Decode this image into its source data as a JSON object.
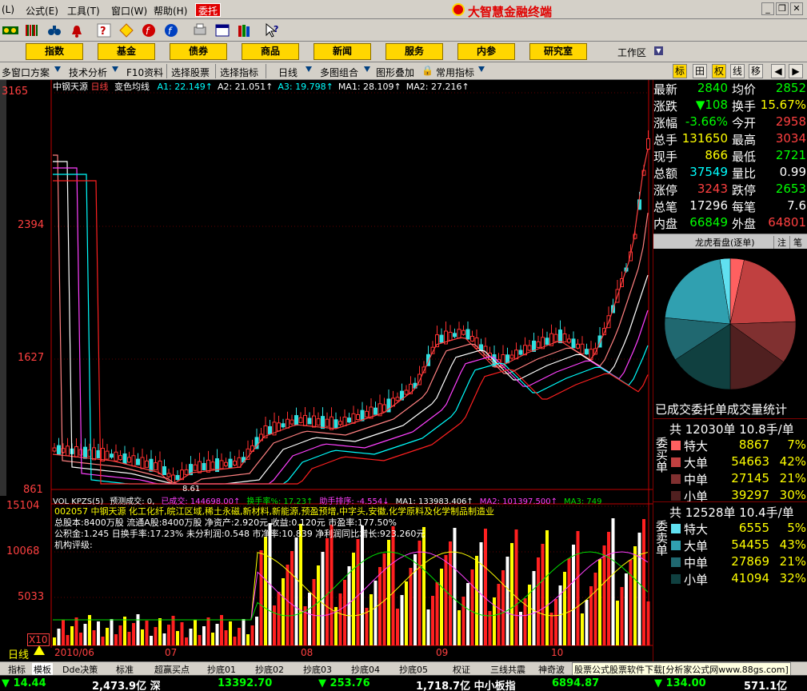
{
  "app_title": "大智慧金融终端",
  "menu": {
    "items": [
      "(L)",
      "公式(E)",
      "工具(T)",
      "窗口(W)",
      "帮助(H)"
    ],
    "weituo": "委托"
  },
  "categories": [
    "指数",
    "基金",
    "债券",
    "商品",
    "新闻",
    "服务",
    "内参",
    "研究室"
  ],
  "workspace": "工作区",
  "subtoolbar": {
    "items": [
      "多窗口方案",
      "技术分析",
      "F10资料",
      "选择股票",
      "选择指标",
      "日线",
      "多图组合",
      "图形叠加",
      "常用指标"
    ]
  },
  "right_tabs": [
    "标",
    "田",
    "权",
    "线",
    "移"
  ],
  "chart": {
    "stock_name": "中钢天源",
    "period": "日线",
    "indicator": "变色均线",
    "ma_line": [
      {
        "label": "A1: 22.149↑",
        "value": "22.149↑",
        "color": "#00ffff"
      },
      {
        "label": "A2: 21.051↑",
        "value": "21.051↑",
        "color": "#ffffff"
      },
      {
        "label": "A3: 19.798↑",
        "value": "19.798↑",
        "color": "#00ffff"
      },
      {
        "label": "MA1: 28.109↑",
        "value": "28.109↑",
        "color": "#ffffff"
      },
      {
        "label": "MA2: 27.216↑",
        "value": "",
        "color": "#ffffff"
      }
    ],
    "price_axis": [
      "3165",
      "2394",
      "1627",
      "861"
    ],
    "low_label": "8.61",
    "vol_header": [
      {
        "t": "VOL KPZS(5)",
        "c": "#ffffff"
      },
      {
        "t": "预测成交: 0,",
        "c": "#ffffff"
      },
      {
        "t": "已成交: 144698.00↑",
        "c": "#ff40ff"
      },
      {
        "t": "换手率%: 17.23↑",
        "c": "#00e000"
      },
      {
        "t": "助手排序: -4.554↓",
        "c": "#ff40ff"
      },
      {
        "t": "MA1: 133983.406↑",
        "c": "#ffffff"
      },
      {
        "t": "MA2: 101397.500↑",
        "c": "#ff40ff"
      },
      {
        "t": "MA3: 749",
        "c": "#00e000"
      }
    ],
    "info_lines": [
      "002057 中钢天源 化工化纤,皖江区域,稀土永磁,新材料,新能源,预盈预增,中字头,安徽,化学原料及化学制品制造业",
      "总股本:8400万股 流通A股:8400万股 净资产:2.920元 收益:0.120元 市盈率:177.50%",
      "公积金:1.245 日换手率:17.23% 未分利润:0.548 市净率:10.839 净利润同比增长:923.260元",
      "机构评级:"
    ],
    "vol_axis": [
      "15104",
      "10068",
      "5033",
      "X10"
    ],
    "date_axis": [
      "2010/06",
      "07",
      "08",
      "09",
      "10"
    ],
    "period_tag": "日线"
  },
  "quote": [
    {
      "l1": "最新",
      "v1": "2840",
      "c1": "#00ff00",
      "l2": "均价",
      "v2": "2852",
      "c2": "#00ff00"
    },
    {
      "l1": "涨跌",
      "v1": "▼108",
      "c1": "#00ff00",
      "l2": "换手",
      "v2": "15.67%",
      "c2": "#ffff00"
    },
    {
      "l1": "涨幅",
      "v1": "-3.66%",
      "c1": "#00ff00",
      "l2": "今开",
      "v2": "2958",
      "c2": "#ff4040"
    },
    {
      "l1": "总手",
      "v1": "131650",
      "c1": "#ffff00",
      "l2": "最高",
      "v2": "3034",
      "c2": "#ff4040"
    },
    {
      "l1": "现手",
      "v1": "866",
      "c1": "#ffff00",
      "l2": "最低",
      "v2": "2721",
      "c2": "#00ff00"
    },
    {
      "l1": "总额",
      "v1": "37549",
      "c1": "#00ffff",
      "l2": "量比",
      "v2": "0.99",
      "c2": "#ffffff"
    },
    {
      "l1": "涨停",
      "v1": "3243",
      "c1": "#ff4040",
      "l2": "跌停",
      "v2": "2653",
      "c2": "#00ff00"
    },
    {
      "l1": "总笔",
      "v1": "17296",
      "c1": "#ffffff",
      "l2": "每笔",
      "v2": "7.6",
      "c2": "#ffffff"
    },
    {
      "l1": "内盘",
      "v1": "66849",
      "c1": "#00ff00",
      "l2": "外盘",
      "v2": "64801",
      "c2": "#ff4040"
    }
  ],
  "dragon": {
    "title": "龙虎看盘(逐单)",
    "tab1": "注",
    "tab2": "笔",
    "stats_title": "已成交委托单成交量统计",
    "buy": {
      "label": "委买单",
      "total": "共 12030单 10.8手/单",
      "rows": [
        {
          "name": "特大",
          "vol": "8867",
          "pct": "7%",
          "color": "#ff6060"
        },
        {
          "name": "大单",
          "vol": "54663",
          "pct": "42%",
          "color": "#c04040"
        },
        {
          "name": "中单",
          "vol": "27145",
          "pct": "21%",
          "color": "#803030"
        },
        {
          "name": "小单",
          "vol": "39297",
          "pct": "30%",
          "color": "#502020"
        }
      ]
    },
    "sell": {
      "label": "委卖单",
      "total": "共 12528单 10.4手/单",
      "rows": [
        {
          "name": "特大",
          "vol": "6555",
          "pct": "5%",
          "color": "#60e0f0"
        },
        {
          "name": "大单",
          "vol": "54455",
          "pct": "43%",
          "color": "#30a0b0"
        },
        {
          "name": "中单",
          "vol": "27869",
          "pct": "21%",
          "color": "#206870"
        },
        {
          "name": "小单",
          "vol": "41094",
          "pct": "32%",
          "color": "#104040"
        }
      ]
    }
  },
  "tabs": [
    "指标",
    "模板",
    "Dde决策",
    "标准",
    "超赢买点",
    "抄底01",
    "抄底02",
    "抄底03",
    "抄底04",
    "抄底05",
    "权证",
    "三线共震",
    "神奇波",
    "股票公式股票软件下载[分析家公式网www.88gs.com]"
  ],
  "status": [
    {
      "t": "▼ 14.44",
      "c": "#00ff00"
    },
    {
      "t": "2,473.9亿 深",
      "c": "#ffffff"
    },
    {
      "t": "13392.70",
      "c": "#00ff00"
    },
    {
      "t": "▼ 253.76",
      "c": "#00ff00"
    },
    {
      "t": "1,718.7亿 中小板指",
      "c": "#ffffff"
    },
    {
      "t": "6894.87",
      "c": "#00ff00"
    },
    {
      "t": "▼ 134.00",
      "c": "#00ff00"
    },
    {
      "t": "571.1亿",
      "c": "#ffffff"
    }
  ]
}
